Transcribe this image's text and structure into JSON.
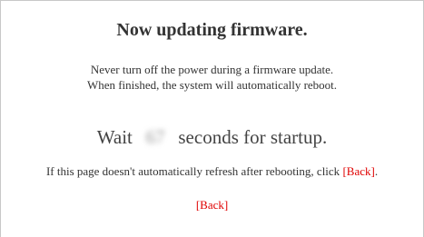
{
  "dialog": {
    "title": "Now updating firmware.",
    "warning_line1": "Never turn off the power during a firmware update.",
    "warning_line2": "When finished, the system will automatically reboot.",
    "wait_prefix": "Wait",
    "countdown_value": "67",
    "wait_suffix": "seconds for startup.",
    "refresh_text": "If this page doesn't automatically refresh after rebooting, click ",
    "refresh_period": ".",
    "back_link_inline": "[Back]",
    "back_link_bottom": "[Back]"
  },
  "colors": {
    "link": "#e00000",
    "text": "#333333",
    "border": "#c8c8c8"
  }
}
